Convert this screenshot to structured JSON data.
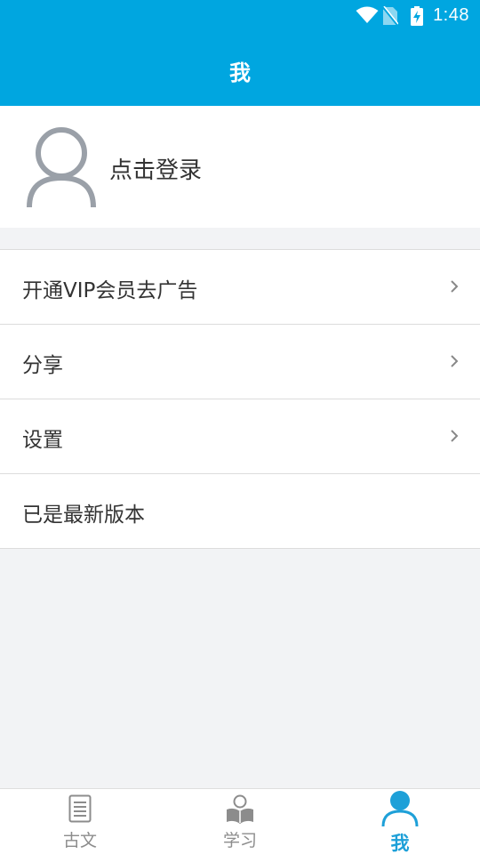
{
  "status_bar": {
    "time": "1:48",
    "icons": [
      "wifi-icon",
      "no-sim-icon",
      "battery-charging-icon"
    ]
  },
  "header": {
    "title": "我"
  },
  "profile": {
    "login_label": "点击登录",
    "avatar_icon": "user-avatar-icon"
  },
  "menu": {
    "items": [
      {
        "label": "开通VIP会员去广告",
        "has_arrow": true
      },
      {
        "label": "分享",
        "has_arrow": true
      },
      {
        "label": "设置",
        "has_arrow": true
      },
      {
        "label": "已是最新版本",
        "has_arrow": false
      }
    ]
  },
  "tabbar": {
    "tabs": [
      {
        "label": "古文",
        "icon": "document-icon",
        "active": false
      },
      {
        "label": "学习",
        "icon": "reading-person-icon",
        "active": false
      },
      {
        "label": "我",
        "icon": "user-icon",
        "active": true
      }
    ]
  },
  "colors": {
    "primary": "#00a6e0",
    "active_tab": "#1ea0d8",
    "inactive_tab": "#8c8c8c",
    "background": "#f2f3f5"
  }
}
